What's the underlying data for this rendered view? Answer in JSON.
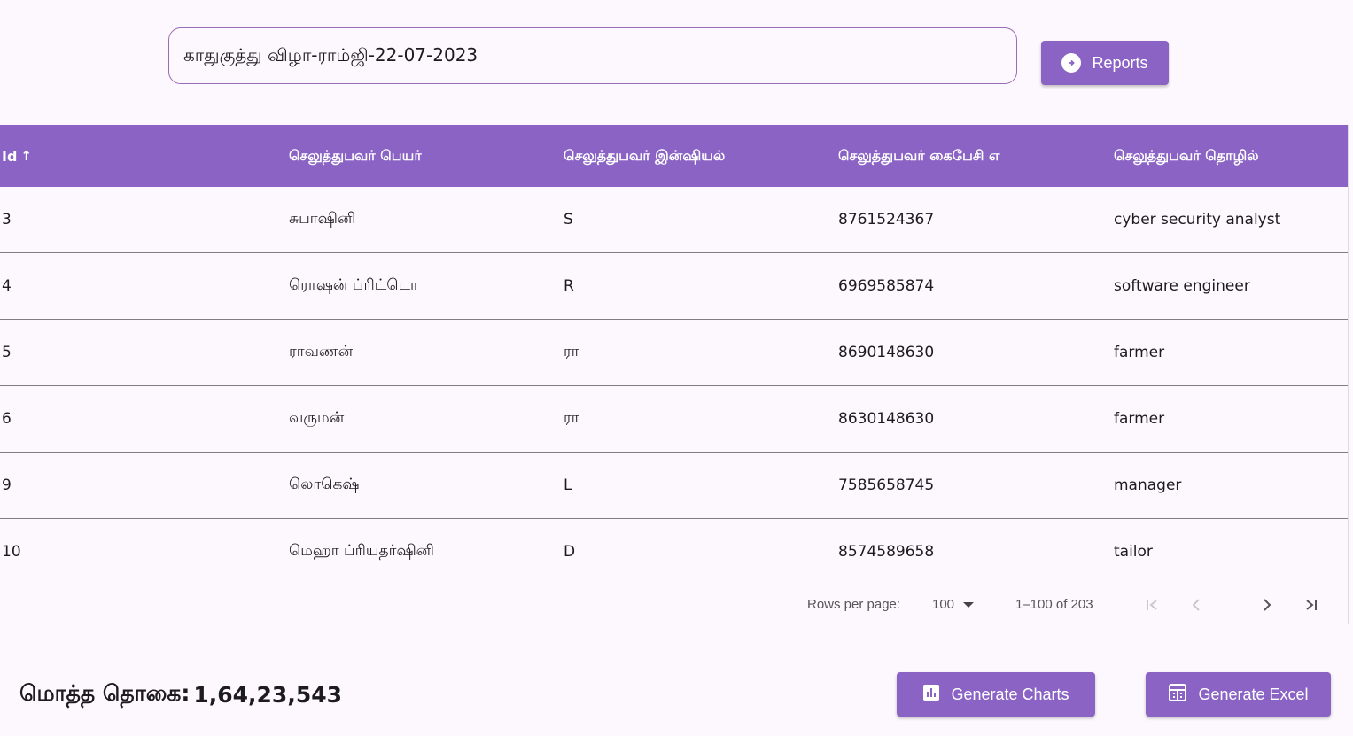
{
  "event_title": "காதுகுத்து விழா-ராம்ஜி-22-07-2023",
  "reports_button": "Reports",
  "table": {
    "columns": [
      "Id",
      "செலுத்துபவர் பெயர்",
      "செலுத்துபவர் இன்ஷியல்",
      "செலுத்துபவர் கைபேசி எ",
      "செலுத்துபவர் தொழில்"
    ],
    "sort_indicator": "↑",
    "rows": [
      [
        "3",
        "சுபாஷினி",
        "S",
        "8761524367",
        "cyber security analyst"
      ],
      [
        "4",
        "ரொஷன் ப்ரிட்டொ",
        "R",
        "6969585874",
        "software engineer"
      ],
      [
        "5",
        "ராவணன்",
        "ரா",
        "8690148630",
        "farmer"
      ],
      [
        "6",
        "வருமன்",
        "ரா",
        "8630148630",
        "farmer"
      ],
      [
        "9",
        "லொகெஷ்",
        "L",
        "7585658745",
        "manager"
      ],
      [
        "10",
        "மெஹா ப்ரியதர்ஷினி",
        "D",
        "8574589658",
        "tailor"
      ]
    ]
  },
  "pagination": {
    "rows_per_page_label": "Rows per page:",
    "rows_per_page_value": "100",
    "range_label": "1–100 of 203"
  },
  "total": {
    "label": "மொத்த தொகை:",
    "value": "1,64,23,543"
  },
  "generate_charts_button": "Generate Charts",
  "generate_excel_button": "Generate Excel",
  "colors": {
    "accent": "#8a63c4",
    "background": "#fdf8fd"
  }
}
